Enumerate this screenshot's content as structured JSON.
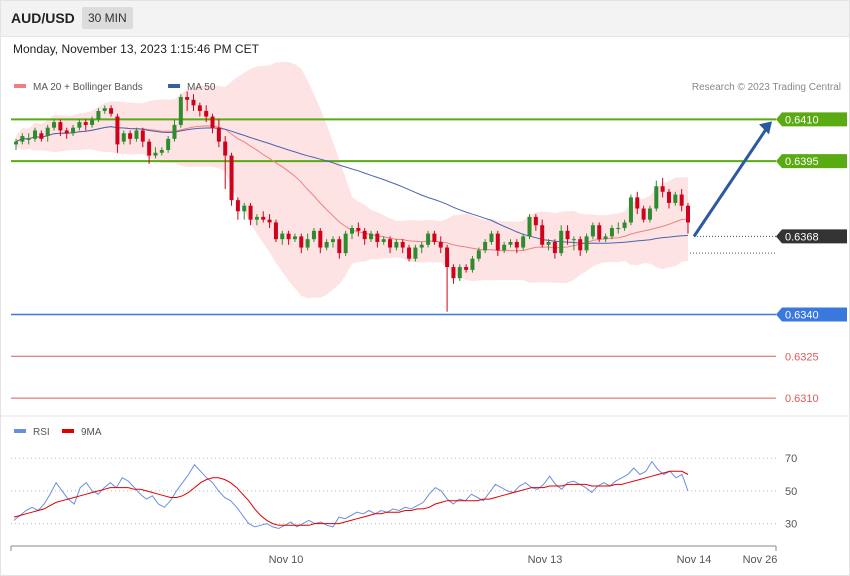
{
  "header": {
    "symbol": "AUD/USD",
    "interval": "30 MIN",
    "datetime": "Monday, November 13, 2023 1:15:46 PM CET"
  },
  "colors": {
    "up": "#2e8b2e",
    "down": "#d0021b",
    "ma20": "#f08080",
    "bands": "#fde0e0",
    "ma50": "#4a64b0",
    "green_level": "#5aaa12",
    "blue_level": "#3a78e0",
    "red_level": "#e05a5a",
    "price_tag": "#333333",
    "arrow": "#2c5aa0",
    "rsi": "#6a8fe0",
    "rsi_ma": "#e00000"
  },
  "chart_data": [
    {
      "type": "candlestick",
      "legend": [
        {
          "label": "MA 20 + Bollinger Bands",
          "color": "#f08080"
        },
        {
          "label": "MA 50",
          "color": "#35609e"
        }
      ],
      "credit": "Research © 2023 Trading Central",
      "ylim": [
        0.6305,
        0.6432
      ],
      "levels": [
        {
          "value": 0.641,
          "label": "0.6410",
          "kind": "resistance",
          "color": "#5aaa12"
        },
        {
          "value": 0.6395,
          "label": "0.6395",
          "kind": "resistance",
          "color": "#5aaa12"
        },
        {
          "value": 0.6368,
          "label": "0.6368",
          "kind": "current",
          "color": "#333333"
        },
        {
          "value": 0.634,
          "label": "0.6340",
          "kind": "pivot",
          "color": "#3a78e0"
        },
        {
          "value": 0.6325,
          "label": "0.6325",
          "kind": "support",
          "color": "#e05a5a"
        },
        {
          "value": 0.631,
          "label": "0.6310",
          "kind": "support",
          "color": "#e05a5a"
        }
      ],
      "projection": {
        "from": 0.6368,
        "to": 0.641
      },
      "candles": [
        [
          0.6401,
          0.6402,
          0.6399,
          0.6403
        ],
        [
          0.6402,
          0.6404,
          0.6401,
          0.6405
        ],
        [
          0.6403,
          0.6403,
          0.6401,
          0.6405
        ],
        [
          0.6403,
          0.6406,
          0.6402,
          0.6407
        ],
        [
          0.6405,
          0.6403,
          0.6402,
          0.6406
        ],
        [
          0.6404,
          0.6407,
          0.6402,
          0.6408
        ],
        [
          0.6407,
          0.6409,
          0.6406,
          0.641
        ],
        [
          0.6409,
          0.6406,
          0.6404,
          0.641
        ],
        [
          0.6406,
          0.6405,
          0.6403,
          0.6407
        ],
        [
          0.6405,
          0.6407,
          0.6404,
          0.6408
        ],
        [
          0.6407,
          0.6409,
          0.6406,
          0.641
        ],
        [
          0.6409,
          0.6408,
          0.6406,
          0.641
        ],
        [
          0.6408,
          0.641,
          0.6407,
          0.6411
        ],
        [
          0.641,
          0.6413,
          0.6409,
          0.6414
        ],
        [
          0.6413,
          0.6414,
          0.6412,
          0.6415
        ],
        [
          0.6414,
          0.6412,
          0.6411,
          0.6415
        ],
        [
          0.6411,
          0.6401,
          0.6398,
          0.6412
        ],
        [
          0.6402,
          0.6405,
          0.6401,
          0.6406
        ],
        [
          0.6405,
          0.6403,
          0.6401,
          0.6406
        ],
        [
          0.6403,
          0.6406,
          0.6402,
          0.6407
        ],
        [
          0.6406,
          0.6402,
          0.64,
          0.6407
        ],
        [
          0.6402,
          0.6397,
          0.6394,
          0.6403
        ],
        [
          0.6397,
          0.6398,
          0.6396,
          0.64
        ],
        [
          0.6398,
          0.6399,
          0.6397,
          0.64
        ],
        [
          0.6399,
          0.6403,
          0.6398,
          0.6404
        ],
        [
          0.6403,
          0.6408,
          0.6402,
          0.641
        ],
        [
          0.6408,
          0.6418,
          0.6407,
          0.6419
        ],
        [
          0.6418,
          0.6417,
          0.6413,
          0.642
        ],
        [
          0.6417,
          0.6415,
          0.6413,
          0.6419
        ],
        [
          0.6415,
          0.6413,
          0.6411,
          0.6416
        ],
        [
          0.6413,
          0.6411,
          0.6409,
          0.6415
        ],
        [
          0.6411,
          0.6407,
          0.6405,
          0.6412
        ],
        [
          0.6407,
          0.6402,
          0.64,
          0.641
        ],
        [
          0.6402,
          0.6397,
          0.6385,
          0.6404
        ],
        [
          0.6397,
          0.6381,
          0.6379,
          0.6398
        ],
        [
          0.6381,
          0.6377,
          0.6374,
          0.6382
        ],
        [
          0.6377,
          0.6379,
          0.6374,
          0.638
        ],
        [
          0.6379,
          0.6374,
          0.6372,
          0.638
        ],
        [
          0.6374,
          0.6375,
          0.6372,
          0.6376
        ],
        [
          0.6375,
          0.6374,
          0.6373,
          0.6377
        ],
        [
          0.6374,
          0.6373,
          0.6371,
          0.6376
        ],
        [
          0.6373,
          0.6367,
          0.6366,
          0.6374
        ],
        [
          0.6367,
          0.6369,
          0.6365,
          0.637
        ],
        [
          0.6369,
          0.6367,
          0.6365,
          0.637
        ],
        [
          0.6367,
          0.6368,
          0.6366,
          0.6369
        ],
        [
          0.6368,
          0.6364,
          0.6362,
          0.6369
        ],
        [
          0.6364,
          0.6367,
          0.6363,
          0.6369
        ],
        [
          0.6367,
          0.637,
          0.6366,
          0.6371
        ],
        [
          0.637,
          0.6364,
          0.6362,
          0.6371
        ],
        [
          0.6364,
          0.6366,
          0.6363,
          0.6367
        ],
        [
          0.6366,
          0.6367,
          0.6364,
          0.6368
        ],
        [
          0.6367,
          0.6362,
          0.636,
          0.6368
        ],
        [
          0.6362,
          0.6369,
          0.6361,
          0.637
        ],
        [
          0.6369,
          0.6371,
          0.6367,
          0.6372
        ],
        [
          0.6371,
          0.637,
          0.6368,
          0.6373
        ],
        [
          0.637,
          0.6367,
          0.6365,
          0.6371
        ],
        [
          0.6367,
          0.6369,
          0.6366,
          0.637
        ],
        [
          0.6369,
          0.6366,
          0.6364,
          0.637
        ],
        [
          0.6366,
          0.6367,
          0.6365,
          0.6368
        ],
        [
          0.6367,
          0.6364,
          0.6362,
          0.6368
        ],
        [
          0.6364,
          0.6366,
          0.6363,
          0.6367
        ],
        [
          0.6366,
          0.6364,
          0.6362,
          0.6367
        ],
        [
          0.6364,
          0.636,
          0.6359,
          0.6365
        ],
        [
          0.636,
          0.6364,
          0.6359,
          0.6365
        ],
        [
          0.6364,
          0.6365,
          0.6362,
          0.6366
        ],
        [
          0.6365,
          0.6369,
          0.6364,
          0.637
        ],
        [
          0.6369,
          0.6366,
          0.6365,
          0.637
        ],
        [
          0.6366,
          0.6364,
          0.6362,
          0.6368
        ],
        [
          0.6364,
          0.6357,
          0.6341,
          0.6365
        ],
        [
          0.6357,
          0.6353,
          0.6351,
          0.6358
        ],
        [
          0.6353,
          0.6357,
          0.6352,
          0.6358
        ],
        [
          0.6357,
          0.6356,
          0.6355,
          0.6358
        ],
        [
          0.6356,
          0.636,
          0.6355,
          0.6361
        ],
        [
          0.636,
          0.6363,
          0.6359,
          0.6364
        ],
        [
          0.6363,
          0.6366,
          0.6362,
          0.6367
        ],
        [
          0.6366,
          0.6369,
          0.6365,
          0.637
        ],
        [
          0.6369,
          0.6363,
          0.6361,
          0.637
        ],
        [
          0.6363,
          0.6365,
          0.6362,
          0.6366
        ],
        [
          0.6365,
          0.6366,
          0.6364,
          0.6367
        ],
        [
          0.6366,
          0.6364,
          0.6362,
          0.6367
        ],
        [
          0.6364,
          0.6368,
          0.6363,
          0.6369
        ],
        [
          0.6368,
          0.6375,
          0.6367,
          0.6376
        ],
        [
          0.6375,
          0.6372,
          0.637,
          0.6376
        ],
        [
          0.6372,
          0.6365,
          0.6364,
          0.6374
        ],
        [
          0.6365,
          0.6366,
          0.6363,
          0.6367
        ],
        [
          0.6366,
          0.6362,
          0.636,
          0.6367
        ],
        [
          0.6362,
          0.637,
          0.6361,
          0.6372
        ],
        [
          0.637,
          0.6367,
          0.6365,
          0.6372
        ],
        [
          0.6367,
          0.6367,
          0.6363,
          0.6368
        ],
        [
          0.6367,
          0.6363,
          0.6361,
          0.6368
        ],
        [
          0.6363,
          0.6368,
          0.6362,
          0.6369
        ],
        [
          0.6368,
          0.6372,
          0.6367,
          0.6373
        ],
        [
          0.6372,
          0.6367,
          0.6366,
          0.6373
        ],
        [
          0.6367,
          0.6368,
          0.6366,
          0.6369
        ],
        [
          0.6368,
          0.6371,
          0.6367,
          0.6372
        ],
        [
          0.6371,
          0.6371,
          0.6369,
          0.6373
        ],
        [
          0.6371,
          0.6373,
          0.637,
          0.6374
        ],
        [
          0.6373,
          0.6382,
          0.6372,
          0.6383
        ],
        [
          0.6382,
          0.6378,
          0.6376,
          0.6384
        ],
        [
          0.6378,
          0.6374,
          0.6373,
          0.6379
        ],
        [
          0.6374,
          0.6378,
          0.6373,
          0.6379
        ],
        [
          0.6378,
          0.6386,
          0.6377,
          0.6388
        ],
        [
          0.6386,
          0.6384,
          0.6382,
          0.6389
        ],
        [
          0.6384,
          0.638,
          0.6378,
          0.6385
        ],
        [
          0.638,
          0.6383,
          0.6379,
          0.6384
        ],
        [
          0.6383,
          0.6379,
          0.6377,
          0.6385
        ],
        [
          0.6379,
          0.6373,
          0.6369,
          0.638
        ]
      ]
    },
    {
      "type": "line",
      "legend": [
        {
          "label": "RSI",
          "color": "#6a8fe0"
        },
        {
          "label": "9MA",
          "color": "#e00000"
        }
      ],
      "ylim": [
        20,
        75
      ],
      "y_ticks": [
        30,
        50,
        70
      ],
      "x_ticks": [
        "Nov 10",
        "Nov 13",
        "Nov 14",
        "Nov 26"
      ],
      "series": [
        {
          "name": "RSI",
          "values": [
            32,
            35,
            38,
            40,
            38,
            42,
            48,
            55,
            50,
            45,
            42,
            52,
            55,
            50,
            48,
            52,
            55,
            52,
            58,
            56,
            52,
            48,
            45,
            47,
            42,
            40,
            44,
            50,
            55,
            60,
            66,
            62,
            58,
            55,
            50,
            46,
            44,
            40,
            35,
            30,
            28,
            29,
            30,
            28,
            27,
            29,
            31,
            28,
            30,
            32,
            30,
            31,
            29,
            28,
            34,
            33,
            35,
            37,
            36,
            38,
            36,
            38,
            37,
            39,
            38,
            40,
            39,
            41,
            43,
            48,
            52,
            50,
            45,
            42,
            45,
            44,
            48,
            46,
            44,
            49,
            54,
            52,
            50,
            49,
            53,
            55,
            52,
            51,
            54,
            59,
            54,
            51,
            55,
            56,
            54,
            52,
            49,
            53,
            55,
            53,
            56,
            58,
            60,
            64,
            60,
            62,
            68,
            63,
            60,
            62,
            58,
            60,
            50
          ]
        },
        {
          "name": "9MA",
          "values": [
            34,
            35,
            36,
            37,
            38,
            39,
            41,
            43,
            44,
            45,
            46,
            47,
            48,
            49,
            50,
            51,
            52,
            52,
            52,
            52,
            51,
            51,
            50,
            49,
            48,
            47,
            46,
            46,
            47,
            49,
            52,
            55,
            57,
            58,
            58,
            57,
            55,
            52,
            48,
            44,
            39,
            35,
            32,
            30,
            29,
            29,
            29,
            29,
            29,
            29,
            30,
            30,
            30,
            30,
            30,
            31,
            32,
            33,
            34,
            35,
            36,
            36,
            37,
            37,
            37,
            38,
            38,
            39,
            39,
            40,
            42,
            43,
            44,
            44,
            44,
            44,
            44,
            44,
            45,
            45,
            46,
            47,
            48,
            49,
            50,
            51,
            52,
            52,
            52,
            53,
            53,
            53,
            54,
            54,
            54,
            54,
            53,
            53,
            53,
            53,
            54,
            54,
            55,
            56,
            57,
            58,
            59,
            60,
            61,
            62,
            62,
            62,
            60
          ]
        }
      ]
    }
  ]
}
